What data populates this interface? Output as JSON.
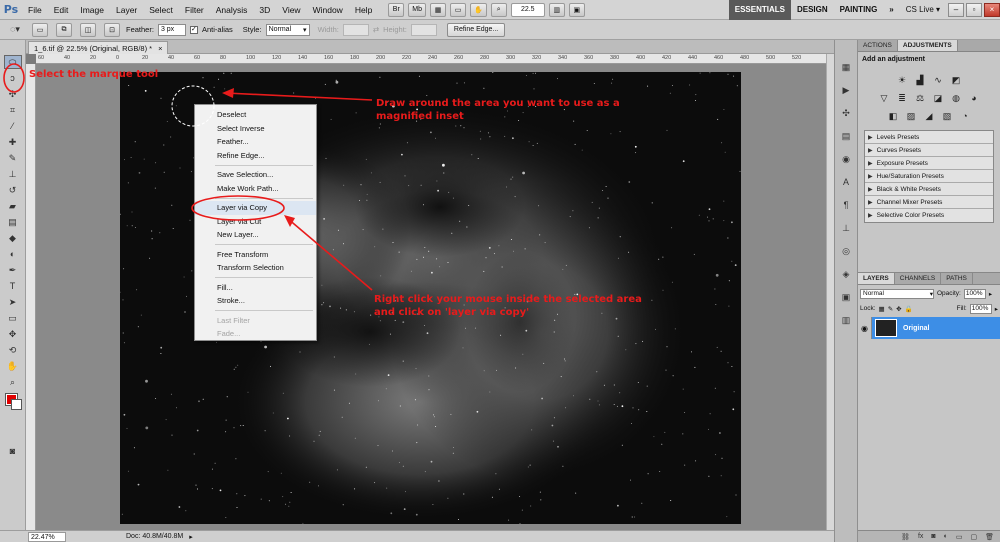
{
  "app": {
    "logo": "Ps"
  },
  "menu": [
    "File",
    "Edit",
    "Image",
    "Layer",
    "Select",
    "Filter",
    "Analysis",
    "3D",
    "View",
    "Window",
    "Help"
  ],
  "menubar_buttons": {
    "br": "Br",
    "mb": "Mb",
    "zoom": "22.5"
  },
  "workspaces": {
    "essentials": "ESSENTIALS",
    "design": "DESIGN",
    "painting": "PAINTING",
    "more": "»",
    "cslive": "CS Live ▾"
  },
  "options": {
    "feather_label": "Feather:",
    "feather_value": "3 px",
    "antialias_label": "Anti-alias",
    "style_label": "Style:",
    "style_value": "Normal",
    "width_label": "Width:",
    "height_label": "Height:",
    "refine_label": "Refine Edge..."
  },
  "document": {
    "tab_title": "1_6.tif @ 22.5% (Original, RGB/8) *",
    "tab_close": "×"
  },
  "ruler_ticks": [
    "60",
    "40",
    "20",
    "0",
    "20",
    "40",
    "60",
    "80",
    "100",
    "120",
    "140",
    "160",
    "180",
    "200",
    "220",
    "240",
    "260",
    "280",
    "300",
    "320",
    "340",
    "360",
    "380",
    "400",
    "420",
    "440",
    "460",
    "480",
    "500",
    "520"
  ],
  "status": {
    "zoom": "22.47%",
    "doc": "Doc: 40.8M/40.8M"
  },
  "context_menu": {
    "items": [
      {
        "label": "Deselect"
      },
      {
        "label": "Select Inverse"
      },
      {
        "label": "Feather..."
      },
      {
        "label": "Refine Edge..."
      },
      {
        "sep": true
      },
      {
        "label": "Save Selection..."
      },
      {
        "label": "Make Work Path..."
      },
      {
        "sep": true
      },
      {
        "label": "Layer via Copy",
        "hover": true
      },
      {
        "label": "Layer via Cut"
      },
      {
        "label": "New Layer..."
      },
      {
        "sep": true
      },
      {
        "label": "Free Transform"
      },
      {
        "label": "Transform Selection"
      },
      {
        "sep": true
      },
      {
        "label": "Fill..."
      },
      {
        "label": "Stroke..."
      },
      {
        "sep": true
      },
      {
        "label": "Last Filter",
        "disabled": true
      },
      {
        "label": "Fade...",
        "disabled": true
      }
    ]
  },
  "annotations": {
    "marquee": "Select the marque tool",
    "draw": "Draw around the area you want to use as a magnified inset",
    "rightclick": "Right click your mouse inside the selected area and click on 'layer via copy'"
  },
  "annotation_color": "#e81b1b",
  "adjustments_panel": {
    "tab_actions": "ACTIONS",
    "tab_adjustments": "ADJUSTMENTS",
    "title": "Add an adjustment",
    "presets": [
      "Levels Presets",
      "Curves Presets",
      "Exposure Presets",
      "Hue/Saturation Presets",
      "Black & White Presets",
      "Channel Mixer Presets",
      "Selective Color Presets"
    ]
  },
  "layers_panel": {
    "tab_layers": "LAYERS",
    "tab_channels": "CHANNELS",
    "tab_paths": "PATHS",
    "blend_mode": "Normal",
    "opacity_label": "Opacity:",
    "opacity_value": "100%",
    "lock_label": "Lock:",
    "fill_label": "Fill:",
    "fill_value": "100%",
    "layer_name": "Original",
    "selected_color": "#3d8ee6"
  }
}
